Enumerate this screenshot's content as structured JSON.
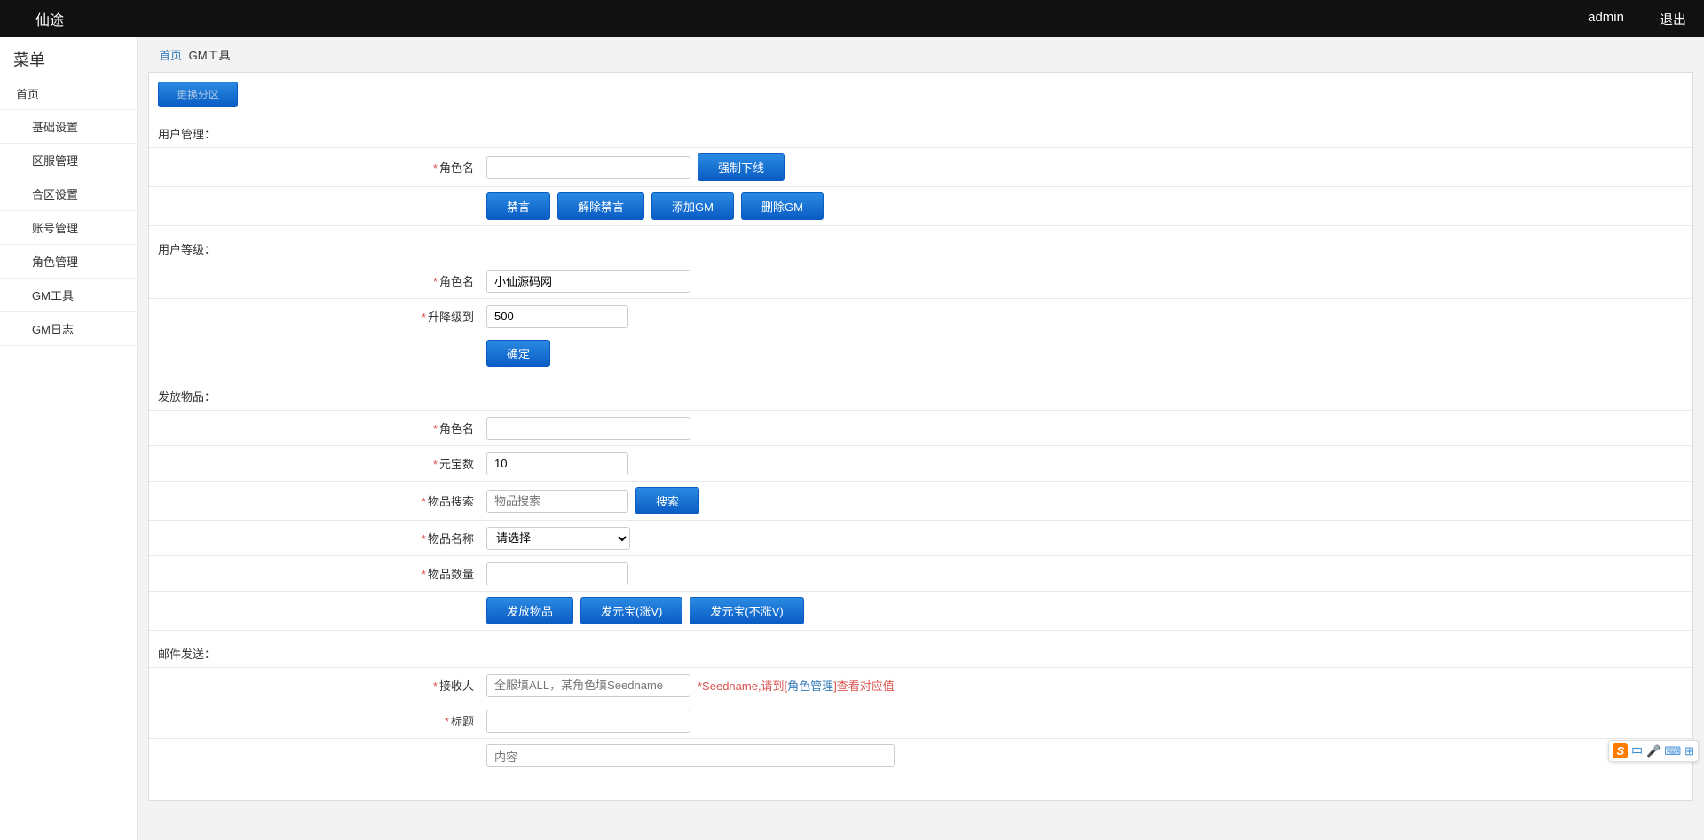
{
  "topbar": {
    "brand": "仙途",
    "user": "admin",
    "logout": "退出"
  },
  "sidebar": {
    "title": "菜单",
    "home": "首页",
    "items": [
      "基础设置",
      "区服管理",
      "合区设置",
      "账号管理",
      "角色管理",
      "GM工具",
      "GM日志"
    ]
  },
  "breadcrumb": {
    "home": "首页",
    "current": "GM工具"
  },
  "change_zone": "更换分区",
  "sec_user_mgmt": {
    "title": "用户管理：",
    "role_label": "角色名",
    "btn_force_offline": "强制下线",
    "btn_mute": "禁言",
    "btn_unmute": "解除禁言",
    "btn_add_gm": "添加GM",
    "btn_del_gm": "删除GM"
  },
  "sec_user_level": {
    "title": "用户等级：",
    "role_label": "角色名",
    "role_value": "小仙源码网",
    "level_label": "升降级到",
    "level_value": "500",
    "btn_confirm": "确定"
  },
  "sec_give_item": {
    "title": "发放物品：",
    "role_label": "角色名",
    "yuanbao_label": "元宝数",
    "yuanbao_value": "10",
    "search_label": "物品搜索",
    "search_placeholder": "物品搜索",
    "btn_search": "搜索",
    "item_name_label": "物品名称",
    "item_name_option": "请选择",
    "item_count_label": "物品数量",
    "btn_give_item": "发放物品",
    "btn_give_yb_v": "发元宝(涨V)",
    "btn_give_yb_nov": "发元宝(不涨V)"
  },
  "sec_mail": {
    "title": "邮件发送：",
    "recv_label": "接收人",
    "recv_placeholder": "全服填ALL，某角色填Seedname",
    "recv_hint_pre": "*Seedname,请到[",
    "recv_hint_link": "角色管理",
    "recv_hint_post": "]查看对应值",
    "subject_label": "标题",
    "content_placeholder": "内容"
  },
  "ime": {
    "logo": "S",
    "lang": "中"
  }
}
